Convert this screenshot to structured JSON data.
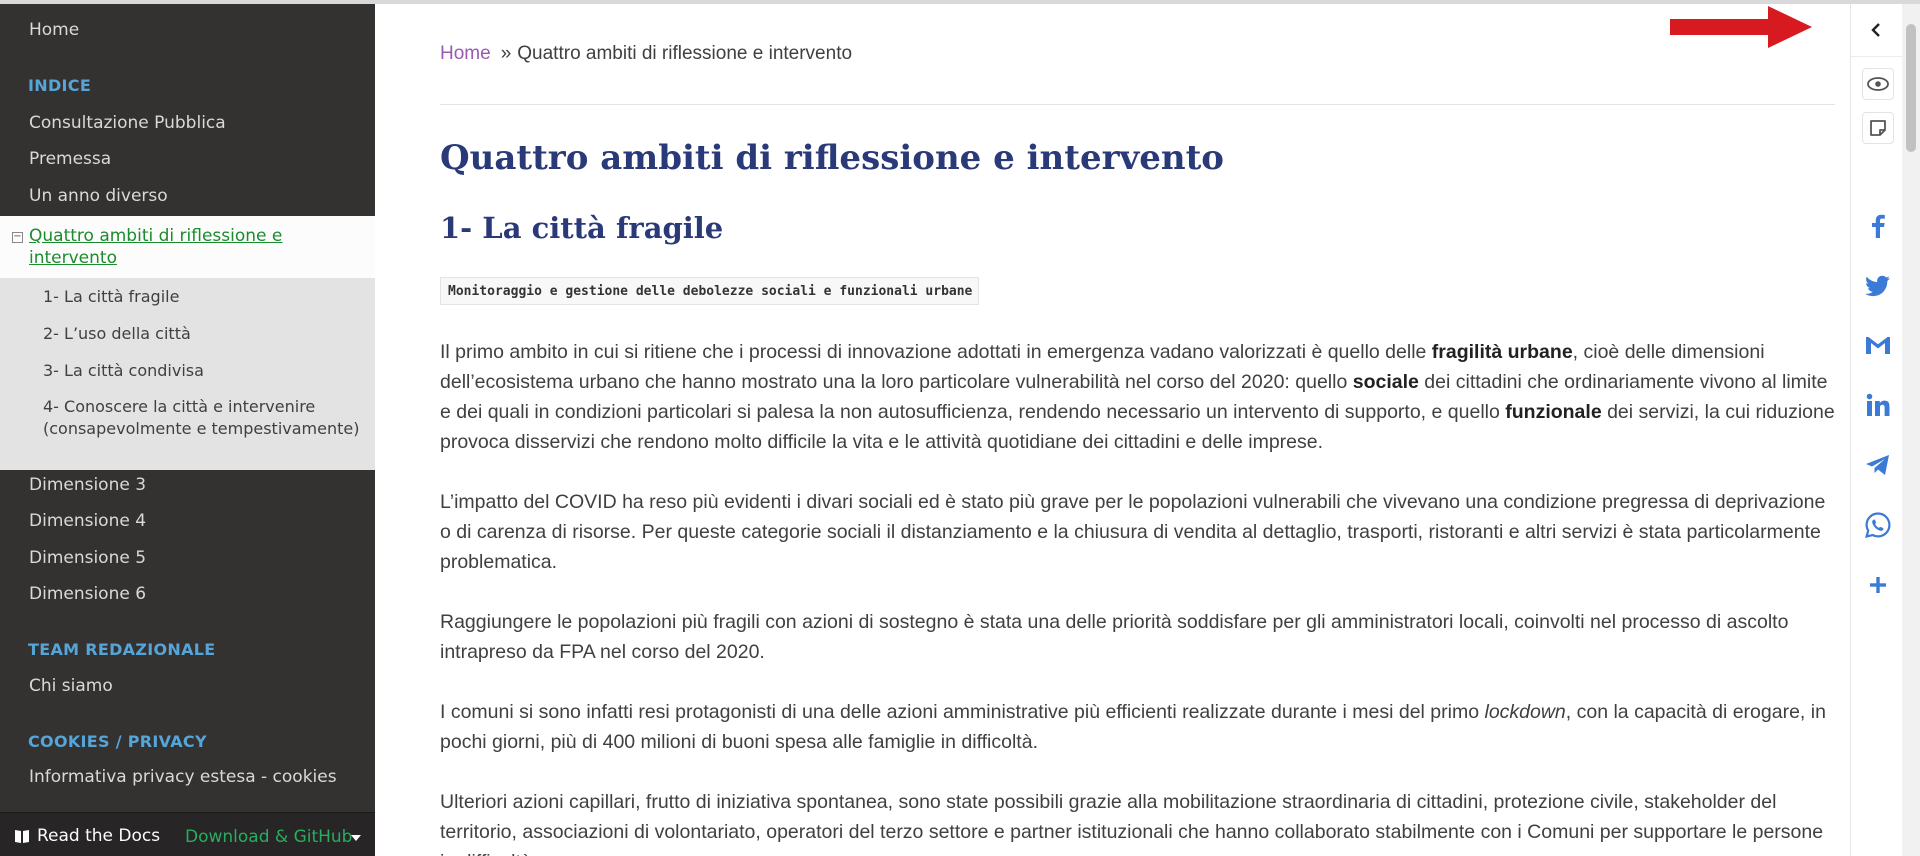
{
  "sidebar": {
    "home": "Home",
    "caption_indice": "INDICE",
    "items": [
      {
        "label": "Consultazione Pubblica"
      },
      {
        "label": "Premessa"
      },
      {
        "label": "Un anno diverso"
      }
    ],
    "current": {
      "label": "Quattro ambiti di riflessione e intervento",
      "toggle": "−"
    },
    "subitems": [
      {
        "label": "1- La città fragile"
      },
      {
        "label": "2- L’uso della città"
      },
      {
        "label": "3- La città condivisa"
      },
      {
        "label": "4- Conoscere la città e intervenire (consapevolmente e tempestivamente)"
      }
    ],
    "dimensions": [
      {
        "label": "Dimensione 3"
      },
      {
        "label": "Dimensione 4"
      },
      {
        "label": "Dimensione 5"
      },
      {
        "label": "Dimensione 6"
      }
    ],
    "caption_team": "TEAM REDAZIONALE",
    "team_item": "Chi siamo",
    "caption_cookies": "COOKIES / PRIVACY",
    "cookies_item": "Informativa privacy estesa - cookies",
    "footer": {
      "rtd": "Read the Docs",
      "download": "Download & GitHub"
    }
  },
  "breadcrumb": {
    "home": "Home",
    "separator": "»",
    "current": "Quattro ambiti di riflessione e intervento"
  },
  "content": {
    "title": "Quattro ambiti di riflessione e intervento",
    "subtitle": "1- La città fragile",
    "code": "Monitoraggio e gestione delle debolezze sociali e funzionali urbane",
    "p1": {
      "a": "Il primo ambito in cui si ritiene che i processi di innovazione adottati in emergenza vadano valorizzati è quello delle ",
      "b1": "fragilità urbane",
      "c": ", cioè delle dimensioni dell’ecosistema urbano che hanno mostrato una la loro particolare vulnerabilità nel corso del 2020: quello ",
      "b2": "sociale",
      "d": " dei cittadini che ordinariamente vivono al limite e dei quali in condizioni particolari si palesa la non autosufficienza, rendendo necessario un intervento di supporto, e quello ",
      "b3": "funzionale",
      "e": " dei servizi, la cui riduzione provoca disservizi che rendono molto difficile la vita e le attività quotidiane dei cittadini e delle imprese."
    },
    "p2": "L’impatto del COVID ha reso più evidenti i divari sociali ed è stato più grave per le popolazioni vulnerabili che vivevano una condizione pregressa di deprivazione o di carenza di risorse. Per queste categorie sociali il distanziamento e la chiusura di vendita al dettaglio, trasporti, ristoranti e altri servizi è stata particolarmente problematica.",
    "p3": "Raggiungere le popolazioni più fragili con azioni di sostegno è stata una delle priorità soddisfare per gli amministratori locali, coinvolti nel processo di ascolto intrapreso da FPA nel corso del 2020.",
    "p4": {
      "a": "I comuni si sono infatti resi protagonisti di una delle azioni amministrative più efficienti realizzate durante i mesi del primo ",
      "i": "lockdown",
      "b": ", con la capacità di erogare, in pochi giorni, più di 400 milioni di buoni spesa alle famiglie in difficoltà."
    },
    "p5": "Ulteriori azioni capillari, frutto di iniziativa spontanea, sono state possibili grazie alla mobilitazione straordinaria di cittadini, protezione civile, stakeholder del territorio, associazioni di volontariato, operatori del terzo settore e partner istituzionali che hanno collaborato stabilmente con i Comuni per supportare le persone in difficoltà."
  },
  "colors": {
    "sidebar_bg": "#343131",
    "caption": "#55a5d9",
    "heading": "#2a3a78",
    "link": "#9b59b6",
    "current": "#1b8c2d",
    "arrow": "#d71920"
  },
  "share_icons": [
    "facebook-icon",
    "twitter-icon",
    "gmail-icon",
    "linkedin-icon",
    "telegram-icon",
    "whatsapp-icon",
    "plus-icon"
  ]
}
